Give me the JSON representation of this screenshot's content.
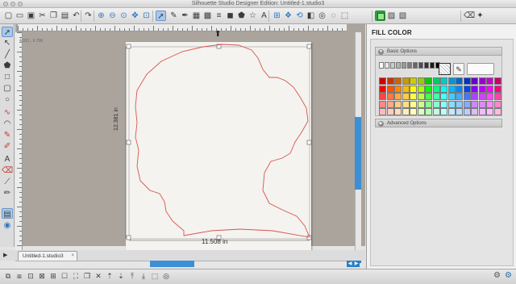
{
  "window": {
    "title": "Silhouette Studio Designer Edition: Untitled-1.studio3"
  },
  "toolbar": {
    "icons": [
      "new-file-icon",
      "open-icon",
      "save-icon",
      "cut-icon",
      "copy-icon",
      "paste-icon",
      "undo-icon",
      "redo-icon",
      "zoom-in-icon",
      "zoom-out-icon",
      "zoom-select-icon",
      "drag-icon",
      "fit-page-icon",
      "pointer-icon",
      "draw-icon",
      "pen-icon",
      "grid-icon",
      "fill-icon",
      "line-style-icon",
      "shape-icon",
      "polygon-icon",
      "star-icon",
      "text-style-icon",
      "align-icon",
      "replicate-icon",
      "transform-icon",
      "modify-icon",
      "offset-icon",
      "trace-icon",
      "spacer-icon",
      "fill-panel-icon",
      "gradient-icon",
      "pattern-icon",
      "eraser-icon",
      "cut-settings-icon"
    ]
  },
  "left_tools": [
    "edit-points-icon",
    "select-icon",
    "line-icon",
    "polygon-icon",
    "rectangle-icon",
    "rounded-rectangle-icon",
    "ellipse-icon",
    "curve-icon",
    "arc-icon",
    "freehand-icon",
    "smooth-freehand-icon",
    "text-icon",
    "eraser-icon",
    "knife-icon",
    "sketch-icon",
    "layer-icon",
    "library-icon"
  ],
  "ruler": {
    "coords": "4.021 , 6.706"
  },
  "canvas": {
    "width_label": "11.508 in",
    "height_label": "12.381 in"
  },
  "tabs": [
    {
      "label": "Untitled-1.studio3"
    }
  ],
  "panel": {
    "title": "FILL COLOR",
    "basic_options": "Basic Options",
    "advanced_options": "Advanced Options",
    "grays": [
      "#ffffff",
      "#e6e6e6",
      "#cccccc",
      "#b3b3b3",
      "#999999",
      "#808080",
      "#666666",
      "#4d4d4d",
      "#333333",
      "#1a1a1a",
      "#000000"
    ],
    "colors": [
      [
        "#cc0000",
        "#cc3300",
        "#cc6600",
        "#cc9900",
        "#cccc00",
        "#99cc00",
        "#00cc00",
        "#00cc66",
        "#00cccc",
        "#0099cc",
        "#0066cc",
        "#0033cc",
        "#6600cc",
        "#9900cc",
        "#cc00cc",
        "#cc0066"
      ],
      [
        "#ff0000",
        "#ff5500",
        "#ff8800",
        "#ffbb00",
        "#ffff00",
        "#aaff00",
        "#00ff00",
        "#00ff88",
        "#00ffff",
        "#00bbff",
        "#0088ff",
        "#0044ff",
        "#8800ff",
        "#bb00ff",
        "#ff00ff",
        "#ff0088"
      ],
      [
        "#ff4444",
        "#ff7744",
        "#ffaa44",
        "#ffcc44",
        "#ffff44",
        "#bbff44",
        "#44ff44",
        "#44ffaa",
        "#44ffff",
        "#44ccff",
        "#44aaff",
        "#4477ff",
        "#aa44ff",
        "#cc44ff",
        "#ff44ff",
        "#ff44aa"
      ],
      [
        "#ff8888",
        "#ffaa88",
        "#ffcc88",
        "#ffdd88",
        "#ffff88",
        "#ccff88",
        "#88ff88",
        "#88ffcc",
        "#88ffff",
        "#88ddff",
        "#88ccff",
        "#88aaff",
        "#cc88ff",
        "#dd88ff",
        "#ff88ff",
        "#ff88cc"
      ],
      [
        "#ffbbbb",
        "#ffccbb",
        "#ffddbb",
        "#ffeebb",
        "#ffffbb",
        "#ddffbb",
        "#bbffbb",
        "#bbffdd",
        "#bbffff",
        "#bbeeff",
        "#bbddff",
        "#bbccff",
        "#ddbbff",
        "#eebbff",
        "#ffbbff",
        "#ffbbdd"
      ]
    ]
  },
  "colors": {
    "accent": "#3b8fd4",
    "outline": "#d9534f"
  }
}
